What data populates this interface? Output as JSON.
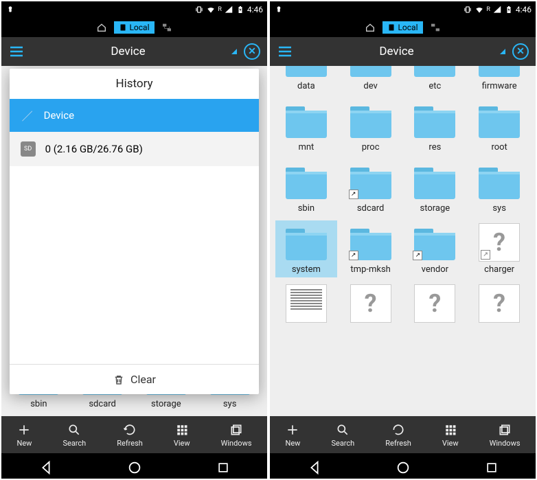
{
  "status": {
    "time": "4:46",
    "roaming": "R"
  },
  "tabs": {
    "local_label": "Local"
  },
  "header": {
    "title": "Device"
  },
  "dialog": {
    "title": "History",
    "items": [
      {
        "label": "Device"
      },
      {
        "label": "0 (2.16 GB/26.76 GB)"
      }
    ],
    "clear_label": "Clear"
  },
  "left_bg_row": [
    "sbin",
    "sdcard",
    "storage",
    "sys"
  ],
  "right_folders_row0": [
    "data",
    "dev",
    "etc",
    "firmware"
  ],
  "right_folders": [
    {
      "label": "mnt",
      "type": "folder"
    },
    {
      "label": "proc",
      "type": "folder"
    },
    {
      "label": "res",
      "type": "folder"
    },
    {
      "label": "root",
      "type": "folder"
    },
    {
      "label": "sbin",
      "type": "folder"
    },
    {
      "label": "sdcard",
      "type": "folder",
      "link": true
    },
    {
      "label": "storage",
      "type": "folder"
    },
    {
      "label": "sys",
      "type": "folder"
    },
    {
      "label": "system",
      "type": "folder",
      "selected": true
    },
    {
      "label": "tmp-mksh",
      "type": "folder",
      "link": true
    },
    {
      "label": "vendor",
      "type": "folder",
      "link": true
    },
    {
      "label": "charger",
      "type": "file-unknown",
      "link": true
    },
    {
      "label": "",
      "type": "file-text"
    },
    {
      "label": "",
      "type": "file-unknown"
    },
    {
      "label": "",
      "type": "file-unknown"
    },
    {
      "label": "",
      "type": "file-unknown"
    }
  ],
  "toolbar": {
    "new": "New",
    "search": "Search",
    "refresh": "Refresh",
    "view": "View",
    "windows": "Windows"
  }
}
